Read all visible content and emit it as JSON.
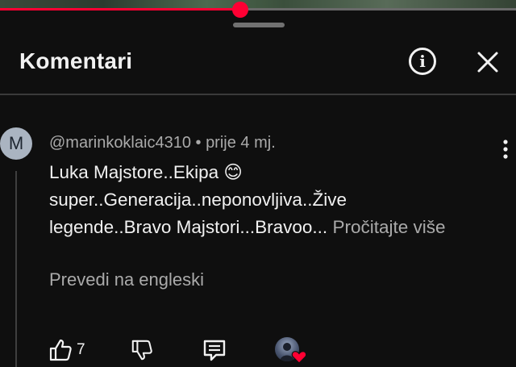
{
  "player": {
    "progress_fraction": 0.465,
    "accent_color": "#ff0033"
  },
  "header": {
    "title": "Komentari",
    "info_glyph": "i",
    "info_icon": "info-circle-icon",
    "close_icon": "close-icon"
  },
  "comment": {
    "avatar_letter": "M",
    "author": "@marinkoklaic4310",
    "separator": " • ",
    "age": "prije 4 mj.",
    "text_lines": [
      "Luka Majstore..Ekipa 😊",
      "super..Generacija..neponovljiva..Žive",
      "legende..Bravo Majstori...Bravoo..."
    ],
    "read_more": "Pročitajte više",
    "translate": "Prevedi na engleski",
    "likes": "7",
    "actions": {
      "like_icon": "thumbs-up-icon",
      "dislike_icon": "thumbs-down-icon",
      "reply_icon": "reply-icon",
      "creator_heart_icon": "creator-heart-icon"
    }
  }
}
